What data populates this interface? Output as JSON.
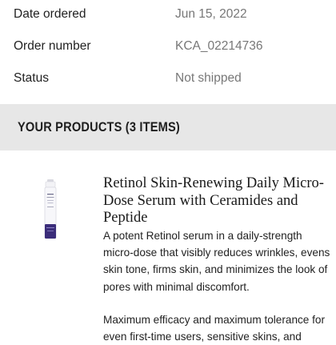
{
  "order": {
    "rows": [
      {
        "label": "Date ordered",
        "value": "Jun 15, 2022"
      },
      {
        "label": "Order number",
        "value": "KCA_02214736"
      },
      {
        "label": "Status",
        "value": "Not shipped"
      }
    ]
  },
  "products_section": {
    "title": "YOUR PRODUCTS (3 ITEMS)"
  },
  "product": {
    "name": "Retinol Skin-Renewing Daily Micro-Dose Serum with Ceramides and Peptide",
    "description": "A potent Retinol serum in a daily-strength micro-dose that visibly reduces wrinkles, evens skin tone, firms skin, and minimizes the look of pores with minimal discomfort.",
    "description_2": "Maximum efficacy and maximum tolerance for even first-time users, sensitive skins, and",
    "image_alt": "product-bottle"
  }
}
